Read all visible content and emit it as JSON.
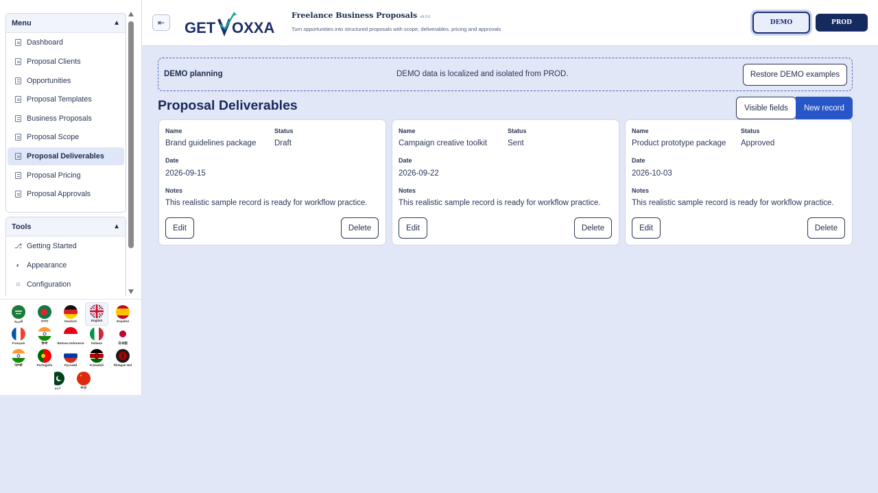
{
  "sidebar": {
    "menu_title": "Menu",
    "menu_items": [
      {
        "label": "Dashboard"
      },
      {
        "label": "Proposal Clients"
      },
      {
        "label": "Opportunities"
      },
      {
        "label": "Proposal Templates"
      },
      {
        "label": "Business Proposals"
      },
      {
        "label": "Proposal Scope"
      },
      {
        "label": "Proposal Deliverables",
        "active": true
      },
      {
        "label": "Proposal Pricing"
      },
      {
        "label": "Proposal Approvals"
      }
    ],
    "tools_title": "Tools",
    "tools_items": [
      {
        "label": "Getting Started",
        "icon": "rocket-icon"
      },
      {
        "label": "Appearance",
        "icon": "palette-icon"
      },
      {
        "label": "Configuration",
        "icon": "gear-icon"
      }
    ],
    "languages": [
      {
        "label": "العربية",
        "flag": "sa"
      },
      {
        "label": "বাংলা",
        "flag": "bd"
      },
      {
        "label": "Deutsch",
        "flag": "de"
      },
      {
        "label": "English",
        "flag": "gb",
        "selected": true
      },
      {
        "label": "Español",
        "flag": "es"
      },
      {
        "label": "Français",
        "flag": "fr"
      },
      {
        "label": "हिन्दी",
        "flag": "in"
      },
      {
        "label": "Bahasa Indonesia",
        "flag": "id"
      },
      {
        "label": "Italiano",
        "flag": "it"
      },
      {
        "label": "日本語",
        "flag": "jp"
      },
      {
        "label": "ਪੰਜਾਬੀ",
        "flag": "in2"
      },
      {
        "label": "Português",
        "flag": "pt"
      },
      {
        "label": "Русский",
        "flag": "ru"
      },
      {
        "label": "Kiswahili",
        "flag": "ke"
      },
      {
        "label": "tlhIngan Hol",
        "flag": "kl"
      },
      {
        "label": "اردو",
        "flag": "pk"
      },
      {
        "label": "中文",
        "flag": "cn"
      }
    ]
  },
  "header": {
    "logo_text_left": "GET",
    "logo_text_right": "OXXA",
    "title": "Freelance Business Proposals",
    "version": "v9.0.0",
    "subtitle": "Turn opportunities into structured proposals with scope, deliverables, pricing and approvals",
    "env_demo": "DEMO",
    "env_prod": "PROD"
  },
  "banner": {
    "title": "DEMO planning",
    "message": "DEMO data is localized and isolated from PROD.",
    "restore_label": "Restore DEMO examples"
  },
  "page": {
    "title": "Proposal Deliverables",
    "visible_fields_label": "Visible fields",
    "new_record_label": "New record"
  },
  "labels": {
    "name": "Name",
    "status": "Status",
    "date": "Date",
    "notes": "Notes",
    "edit": "Edit",
    "delete": "Delete"
  },
  "records": [
    {
      "name": "Brand guidelines package",
      "status": "Draft",
      "date": "2026-09-15",
      "notes": "This realistic sample record is ready for workflow practice."
    },
    {
      "name": "Campaign creative toolkit",
      "status": "Sent",
      "date": "2026-09-22",
      "notes": "This realistic sample record is ready for workflow practice."
    },
    {
      "name": "Product prototype package",
      "status": "Approved",
      "date": "2026-10-03",
      "notes": "This realistic sample record is ready for workflow practice."
    }
  ],
  "colors": {
    "accent": "#2856c7",
    "navy": "#152a5e",
    "background": "#e1e7f7"
  }
}
